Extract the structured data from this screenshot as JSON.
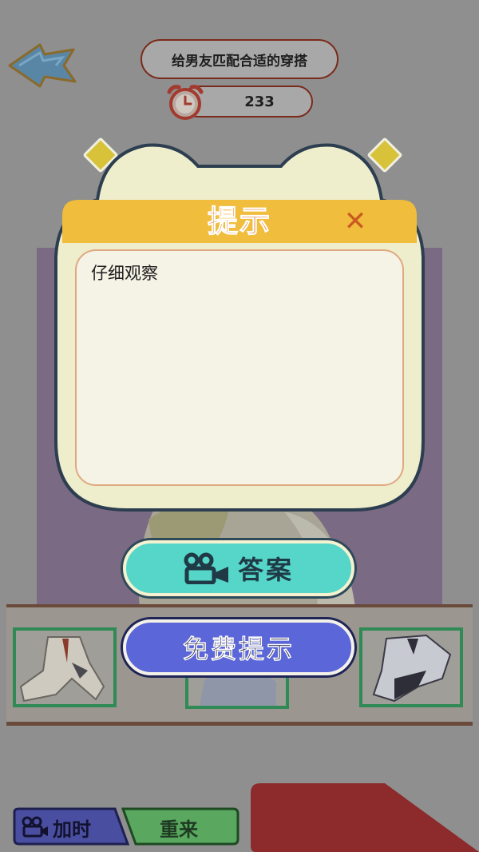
{
  "header": {
    "title": "给男友匹配合适的穿搭",
    "timer_value": "233"
  },
  "bottom_bar": {
    "add_time_label": "加时",
    "retry_label": "重来"
  },
  "hint_dialog": {
    "title": "提示",
    "close_symbol": "✕",
    "hint_text": "仔细观察",
    "answer_button_label": "答案",
    "free_hint_button_label": "免费提示"
  },
  "colors": {
    "overlay": "#8f8f8f",
    "dialog_header": "#f0bd3c",
    "dialog_body": "#efefcf",
    "answer_button": "#55d6c8",
    "free_hint_button": "#5b66d8",
    "title_color": "#e1792a",
    "slot_border": "#2f8a55"
  }
}
